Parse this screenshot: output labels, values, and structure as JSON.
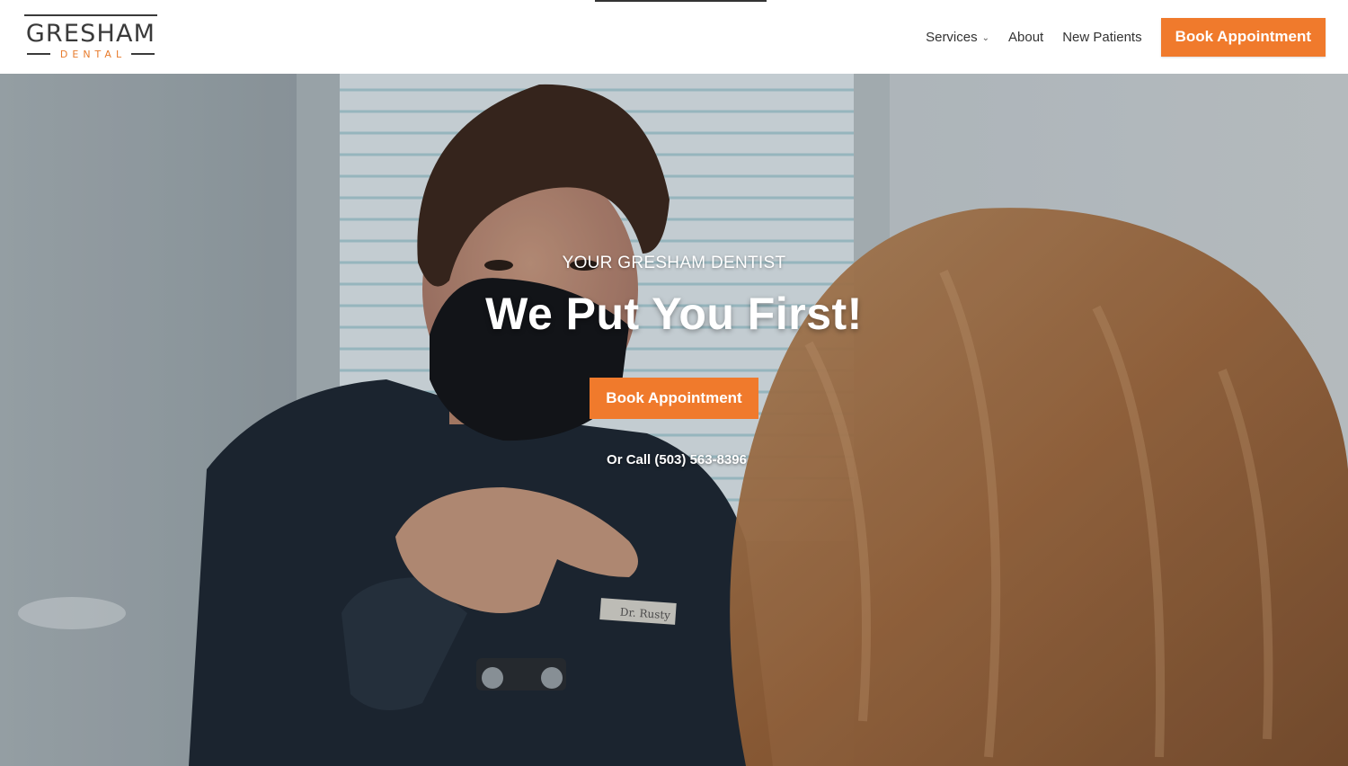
{
  "brand": {
    "name": "GRESHAM",
    "sub": "DENTAL",
    "accent_color": "#f07a2c"
  },
  "nav": {
    "items": [
      {
        "label": "Services",
        "has_dropdown": true
      },
      {
        "label": "About"
      },
      {
        "label": "New Patients"
      }
    ],
    "cta_label": "Book Appointment"
  },
  "hero": {
    "eyebrow": "YOUR GRESHAM DENTIST",
    "headline": "We Put You First!",
    "cta_label": "Book Appointment",
    "call_text": "Or Call (503) 563-8396",
    "name_tag": "Dr. Rusty"
  }
}
